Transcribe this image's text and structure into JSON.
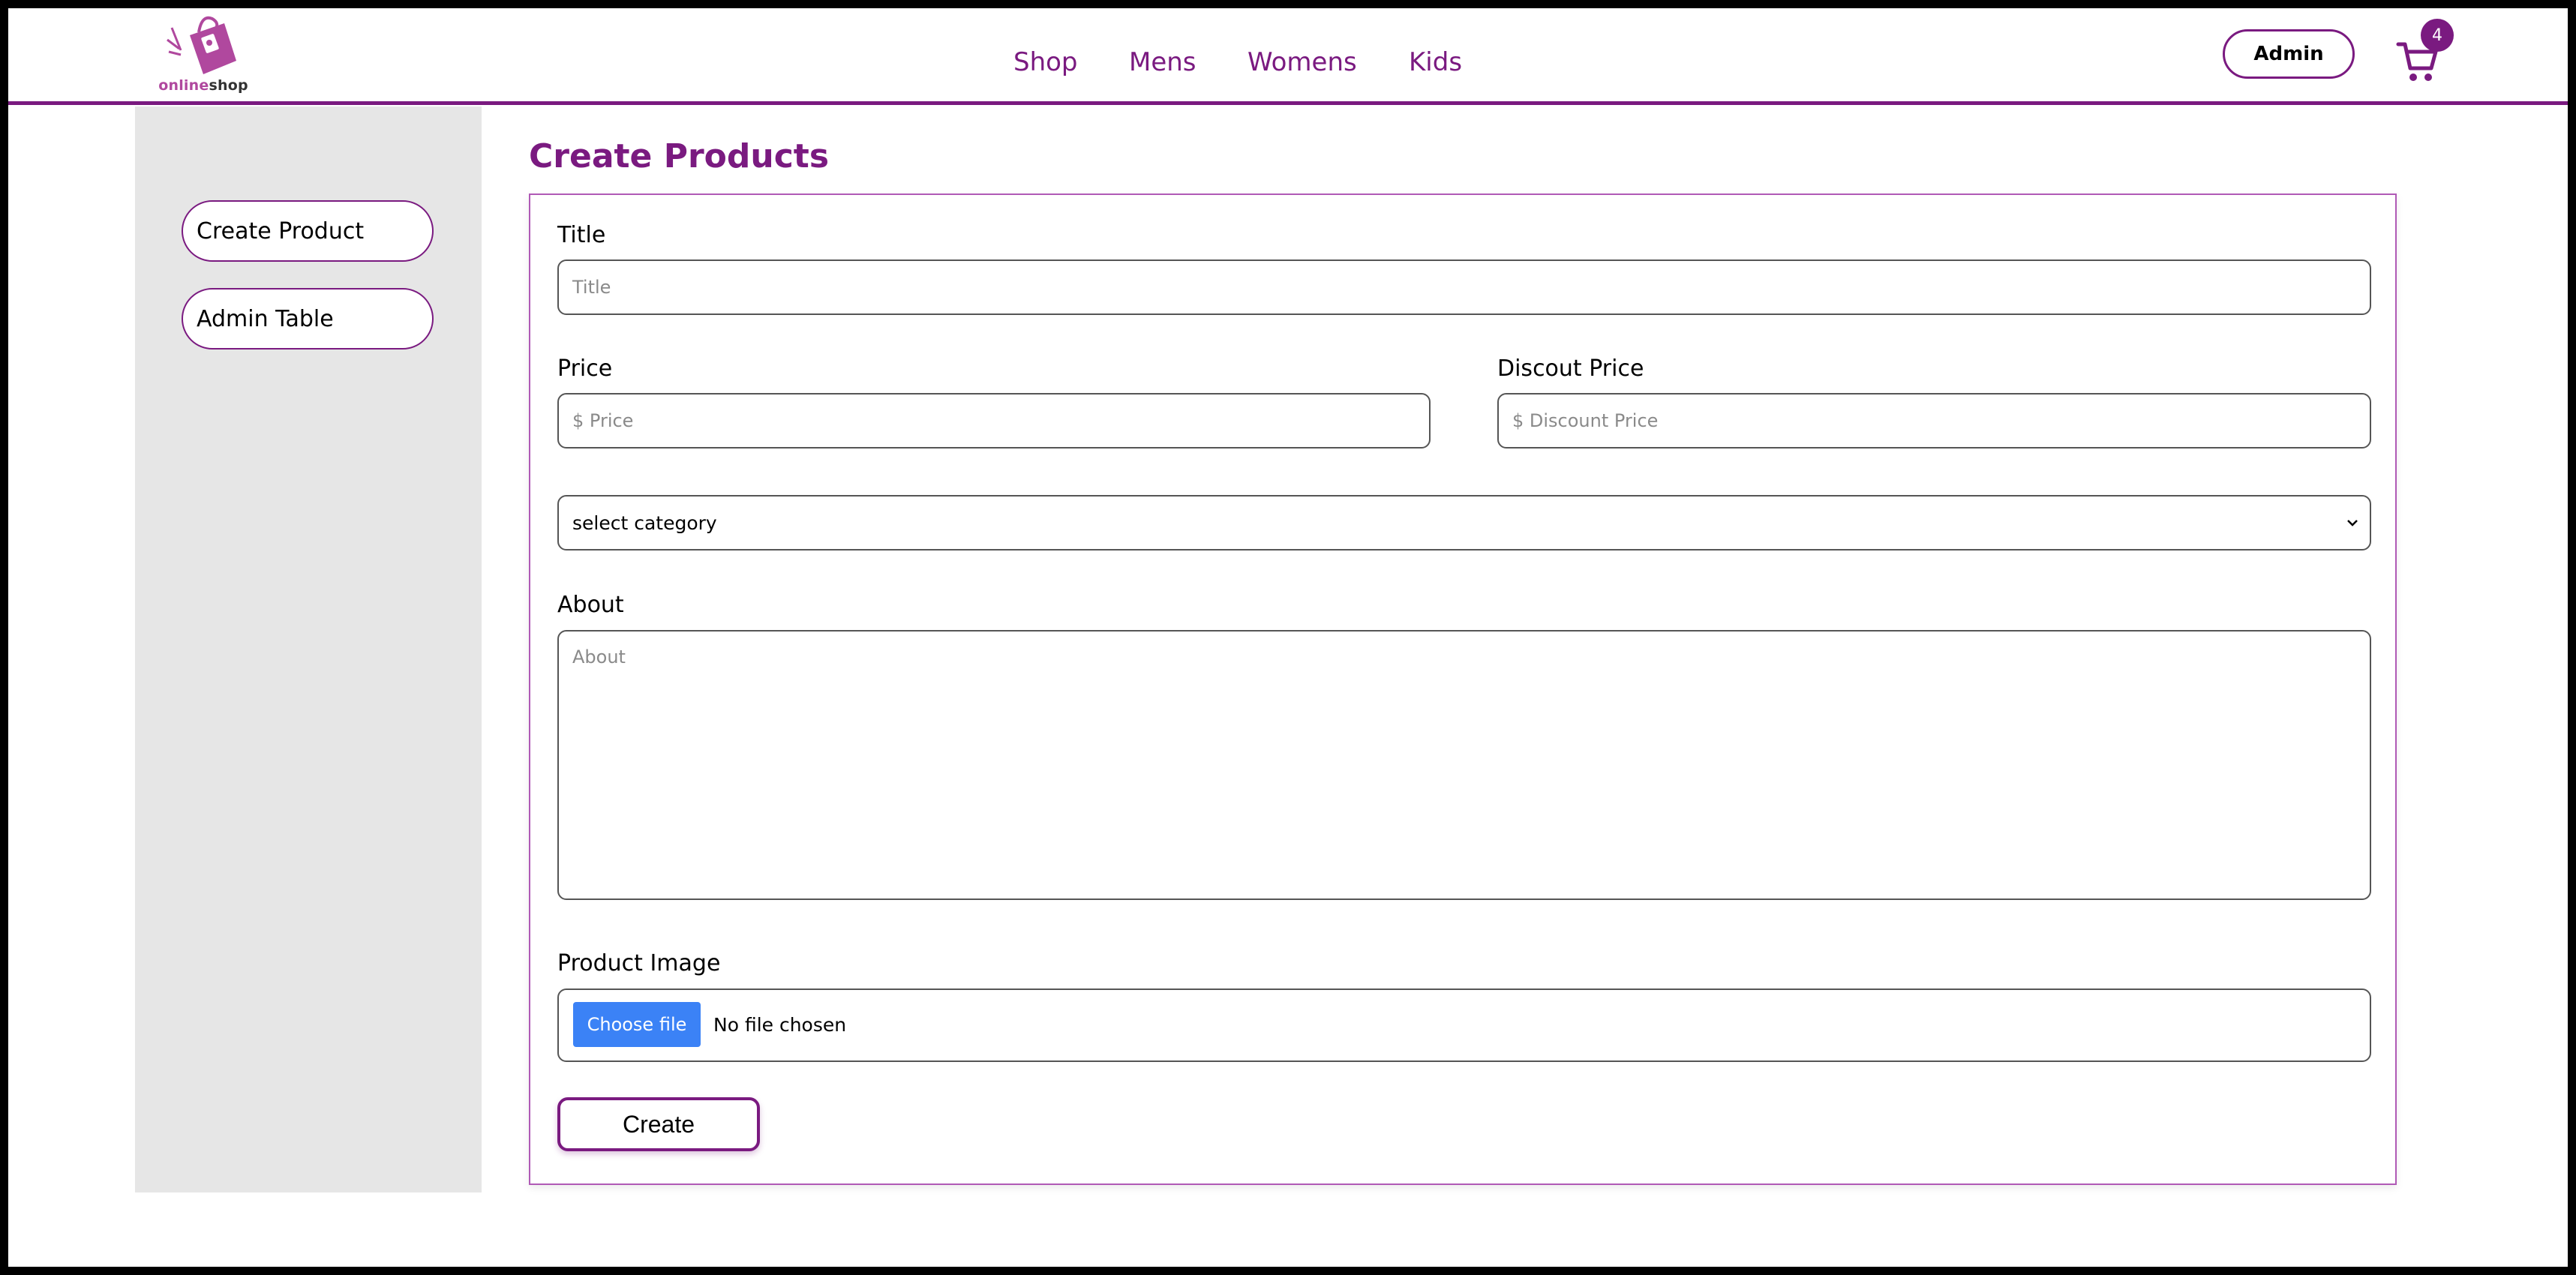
{
  "header": {
    "logo": {
      "text_a": "online",
      "text_b": "shop",
      "icon": "shopping-bag-icon"
    },
    "nav": [
      "Shop",
      "Mens",
      "Womens",
      "Kids"
    ],
    "admin_label": "Admin",
    "cart_count": "4",
    "cart_icon": "cart-icon"
  },
  "sidebar": {
    "items": [
      {
        "label": "Create Product"
      },
      {
        "label": "Admin Table"
      }
    ]
  },
  "main": {
    "title": "Create Products",
    "form": {
      "title_label": "Title",
      "title_placeholder": "Title",
      "price_label": "Price",
      "price_placeholder": "$ Price",
      "discount_label": "Discout Price",
      "discount_placeholder": "$ Discount Price",
      "category_selected": "select category",
      "about_label": "About",
      "about_placeholder": "About",
      "image_label": "Product Image",
      "choose_file": "Choose file",
      "no_file": "No file chosen",
      "create_label": "Create"
    }
  },
  "colors": {
    "accent": "#7a1a80",
    "file_button": "#3b82f6",
    "sidebar_bg": "#e6e6e6"
  }
}
